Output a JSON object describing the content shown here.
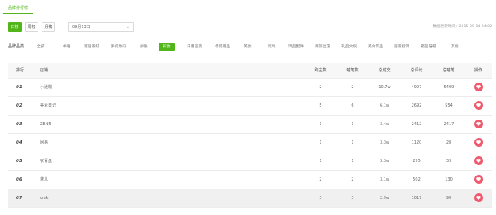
{
  "tab": {
    "label": "品牌排行榜"
  },
  "toolbar": {
    "periods": [
      {
        "label": "日榜",
        "active": true
      },
      {
        "label": "周榜",
        "active": false
      },
      {
        "label": "月榜",
        "active": false
      }
    ],
    "date_value": "09月13日",
    "updated_text": "数据更新时间：2015-09-14 04:00"
  },
  "categories": {
    "label": "品牌品类",
    "items": [
      {
        "label": "全部",
        "active": false
      },
      {
        "label": "书籍",
        "active": false
      },
      {
        "label": "家居家纺",
        "active": false
      },
      {
        "label": "手机数码",
        "active": false
      },
      {
        "label": "护肤",
        "active": false
      },
      {
        "label": "彩妆",
        "active": true
      },
      {
        "label": "日用百货",
        "active": false
      },
      {
        "label": "母婴用品",
        "active": false
      },
      {
        "label": "美妆",
        "active": false
      },
      {
        "label": "玩具",
        "active": false
      },
      {
        "label": "饰品配件",
        "active": false
      },
      {
        "label": "商旅出游",
        "active": false
      },
      {
        "label": "礼品文娱",
        "active": false
      },
      {
        "label": "美食饮品",
        "active": false
      },
      {
        "label": "居家摆饰",
        "active": false
      },
      {
        "label": "箱包鞋帽",
        "active": false
      },
      {
        "label": "其他",
        "active": false
      }
    ]
  },
  "table": {
    "headers": [
      "排行",
      "店铺",
      "跨主数",
      "喵笔数",
      "总成交",
      "总评论",
      "总喵笔",
      "操作"
    ],
    "rows": [
      {
        "rank": "01",
        "name": "小迷糊",
        "a": "2",
        "b": "2",
        "total": "10.7w",
        "reviews": "4997",
        "notes": "5409"
      },
      {
        "rank": "02",
        "name": "美素日记",
        "a": "5",
        "b": "6",
        "total": "6.1w",
        "reviews": "2692",
        "notes": "554"
      },
      {
        "rank": "03",
        "name": "ZENN",
        "a": "1",
        "b": "1",
        "total": "3.4w",
        "reviews": "2412",
        "notes": "2417"
      },
      {
        "rank": "04",
        "name": "网易",
        "a": "1",
        "b": "1",
        "total": "3.3w",
        "reviews": "1120",
        "notes": "28"
      },
      {
        "rank": "05",
        "name": "农青盘",
        "a": "1",
        "b": "1",
        "total": "3.3w",
        "reviews": "295",
        "notes": "33"
      },
      {
        "rank": "06",
        "name": "黛儿",
        "a": "2",
        "b": "2",
        "total": "3.1w",
        "reviews": "502",
        "notes": "130"
      },
      {
        "rank": "07",
        "name": "cmk",
        "a": "3",
        "b": "3",
        "total": "2.9w",
        "reviews": "1017",
        "notes": "90"
      }
    ]
  },
  "colors": {
    "accent": "#52b61a",
    "heart": "#ef5a6f"
  }
}
